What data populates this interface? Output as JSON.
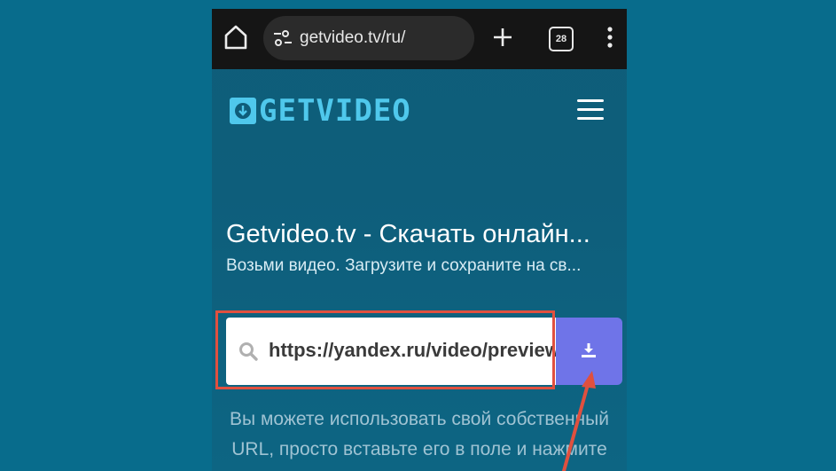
{
  "browser": {
    "url": "getvideo.tv/ru/",
    "tab_count": "28",
    "icons": [
      "home-icon",
      "site-settings-icon",
      "plus-icon",
      "tab-switcher-icon",
      "more-vert-icon"
    ]
  },
  "site": {
    "logo_text": "GETVIDEO",
    "menu_icon": "hamburger-icon"
  },
  "hero": {
    "title": "Getvideo.tv - Скачать онлайн...",
    "subtitle": "Возьми видео. Загрузите и сохраните на св..."
  },
  "search": {
    "value": "https://yandex.ru/video/preview",
    "icon": "search-icon",
    "button_icon": "download-icon"
  },
  "hint": {
    "line1": "Вы можете использовать свой собственный",
    "line2": "URL, просто вставьте его в поле и нажмите"
  },
  "colors": {
    "background": "#086c8c",
    "browser_bar": "#151515",
    "logo": "#4fc8ec",
    "download_button": "#6f74e8",
    "annotation": "#e0503f"
  }
}
